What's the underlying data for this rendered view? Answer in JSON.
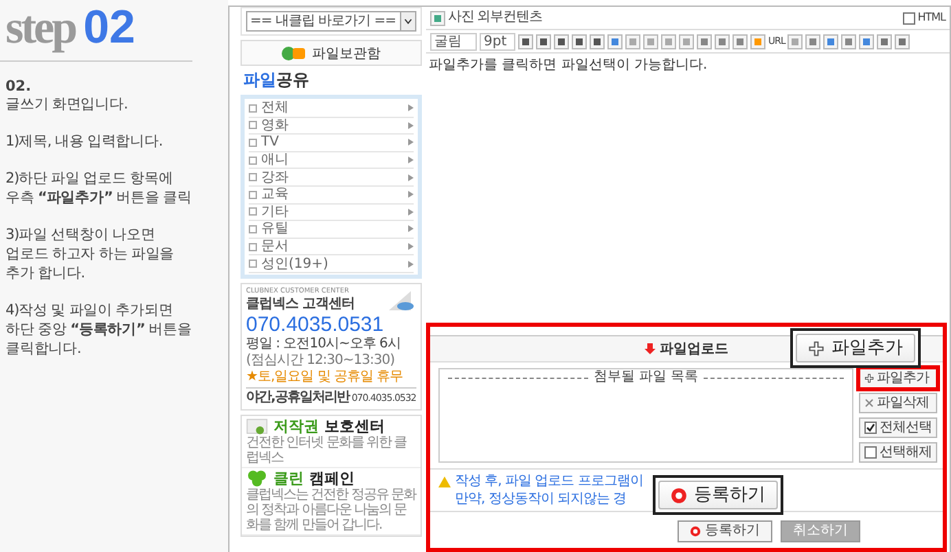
{
  "guide": {
    "step_word": "step",
    "step_number": "02",
    "heading": "02.",
    "lines": [
      "글쓰기 화면입니다.",
      "1)제목, 내용 입력합니다.",
      "2)하단 파일 업로드 항목에\n우측 **“파일추가”** 버튼을 클릭",
      "3)파일 선택창이 나오면\n업로드 하고자 하는 파일을\n추가 합니다.",
      "4)작성 및 파일이 추가되면\n하단 중앙 **“등록하기”** 버튼을\n클릭합니다."
    ]
  },
  "sidebar": {
    "quick_select": "== 내클립 바로가기 ==",
    "storage_button": "파일보관함",
    "heading": {
      "accent": "파일",
      "rest": "공유"
    },
    "categories": [
      "전체",
      "영화",
      "TV",
      "애니",
      "강좌",
      "교육",
      "기타",
      "유틸",
      "문서",
      "성인(19+)"
    ],
    "support": {
      "caption": "CLUBNEX CUSTOMER CENTER",
      "title": "클럽넥스 고객센터",
      "phone": "070.4035.0531",
      "hours": "평일 : 오전10시~오후 6시",
      "lunch": "(점심시간 12:30~13:30)",
      "closed": "★토,일요일 및 공휴일 휴무",
      "night": "야간,공휴일처리반",
      "night_phone": "070.4035.0532"
    },
    "promos": [
      {
        "title_accent": "저작권",
        "title_rest": " 보호센터",
        "text": "건전한 인터넷 문화를 위한 클럽넥스"
      },
      {
        "title_accent": "클린",
        "title_rest": " 캠페인",
        "text": "클럽넥스는 건전한 정공유 문화의 정착과 아름다운 나눔의 문화를 함께 만들어 갑니다."
      }
    ]
  },
  "editor": {
    "tabs": [
      "사진",
      "외부컨텐츠"
    ],
    "html_label": "HTML",
    "html_checked": false,
    "font": "굴림",
    "size": "9pt",
    "url_label": "URL",
    "content": "파일추가를 클릭하면 파일선택이 가능합니다."
  },
  "upload": {
    "title": "파일업로드",
    "list_label": "첨부될 파일 목록",
    "buttons": [
      {
        "label": "파일추가",
        "kind": "add",
        "highlighted": true
      },
      {
        "label": "파일삭제",
        "kind": "delete",
        "highlighted": false
      },
      {
        "label": "전체선택",
        "kind": "check",
        "checked": true,
        "highlighted": false
      },
      {
        "label": "선택해제",
        "kind": "check",
        "checked": false,
        "highlighted": false
      }
    ],
    "notice": [
      "작성 후, 파일 업로드 프로그램이",
      "만약, 정상동작이 되지않는 경"
    ],
    "actions": [
      {
        "label": "등록하기",
        "kind": "primary"
      },
      {
        "label": "취소하기",
        "kind": "secondary"
      }
    ]
  },
  "callouts": [
    {
      "label": "파일추가",
      "kind": "add"
    },
    {
      "label": "등록하기",
      "kind": "submit"
    }
  ]
}
